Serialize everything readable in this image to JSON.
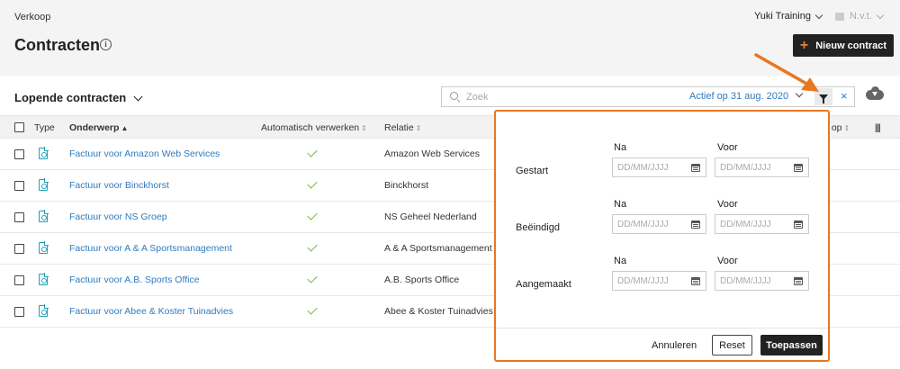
{
  "header": {
    "breadcrumb": "Verkoop",
    "title": "Contracten",
    "company": "Yuki Training",
    "admin": "N.v.t.",
    "new_button": "Nieuw contract"
  },
  "toolbar": {
    "view": "Lopende contracten",
    "search_placeholder": "Zoek",
    "active_filter": "Actief op 31 aug. 2020",
    "clear": "×"
  },
  "table": {
    "columns": {
      "type": "Type",
      "subject": "Onderwerp",
      "auto": "Automatisch verwerken",
      "relation": "Relatie",
      "trailing": "t op"
    },
    "rows": [
      {
        "subject": "Factuur voor Amazon Web Services",
        "relation": "Amazon Web Services"
      },
      {
        "subject": "Factuur voor Binckhorst",
        "relation": "Binckhorst"
      },
      {
        "subject": "Factuur voor NS Groep",
        "relation": "NS Geheel Nederland"
      },
      {
        "subject": "Factuur voor A & A Sportsmanagement",
        "relation": "A & A Sportsmanagement"
      },
      {
        "subject": "Factuur voor A.B. Sports Office",
        "relation": "A.B. Sports Office"
      },
      {
        "subject": "Factuur voor Abee & Koster Tuinadvies",
        "relation": "Abee & Koster Tuinadvies"
      }
    ]
  },
  "filter_popover": {
    "after_label": "Na",
    "before_label": "Voor",
    "date_placeholder": "DD/MM/JJJJ",
    "rows": [
      "Gestart",
      "Beëindigd",
      "Aangemaakt"
    ],
    "cancel": "Annuleren",
    "reset": "Reset",
    "apply": "Toepassen"
  },
  "colors": {
    "accent": "#e87722",
    "link": "#2f7bbf",
    "dark": "#222222",
    "check": "#7cb342",
    "doc_icon": "#20a0b8"
  }
}
